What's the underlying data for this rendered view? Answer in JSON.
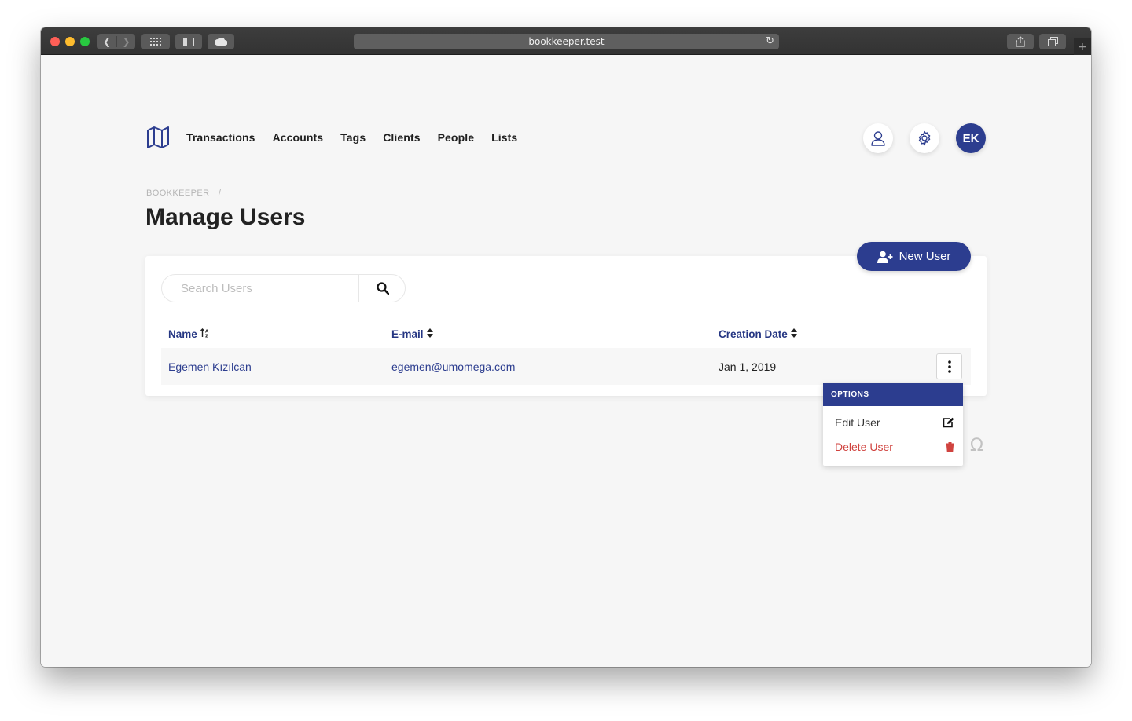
{
  "browser": {
    "url": "bookkeeper.test",
    "plus": "+"
  },
  "nav": {
    "items": [
      "Transactions",
      "Accounts",
      "Tags",
      "Clients",
      "People",
      "Lists"
    ],
    "avatar_initials": "EK"
  },
  "breadcrumb": {
    "root": "BOOKKEEPER",
    "separator": "/"
  },
  "page": {
    "title": "Manage Users",
    "new_user_label": "New User"
  },
  "search": {
    "placeholder": "Search Users"
  },
  "table": {
    "columns": [
      "Name",
      "E-mail",
      "Creation Date"
    ],
    "rows": [
      {
        "name": "Egemen Kızılcan",
        "email": "egemen@umomega.com",
        "created": "Jan 1, 2019"
      }
    ]
  },
  "options_menu": {
    "title": "OPTIONS",
    "items": [
      {
        "label": "Edit User",
        "icon": "edit-icon"
      },
      {
        "label": "Delete User",
        "icon": "trash-icon"
      }
    ]
  },
  "misc": {
    "omega_glyph": "Ω"
  },
  "colors": {
    "primary": "#2c3d8f",
    "danger": "#d0433f",
    "background": "#f6f6f6"
  }
}
